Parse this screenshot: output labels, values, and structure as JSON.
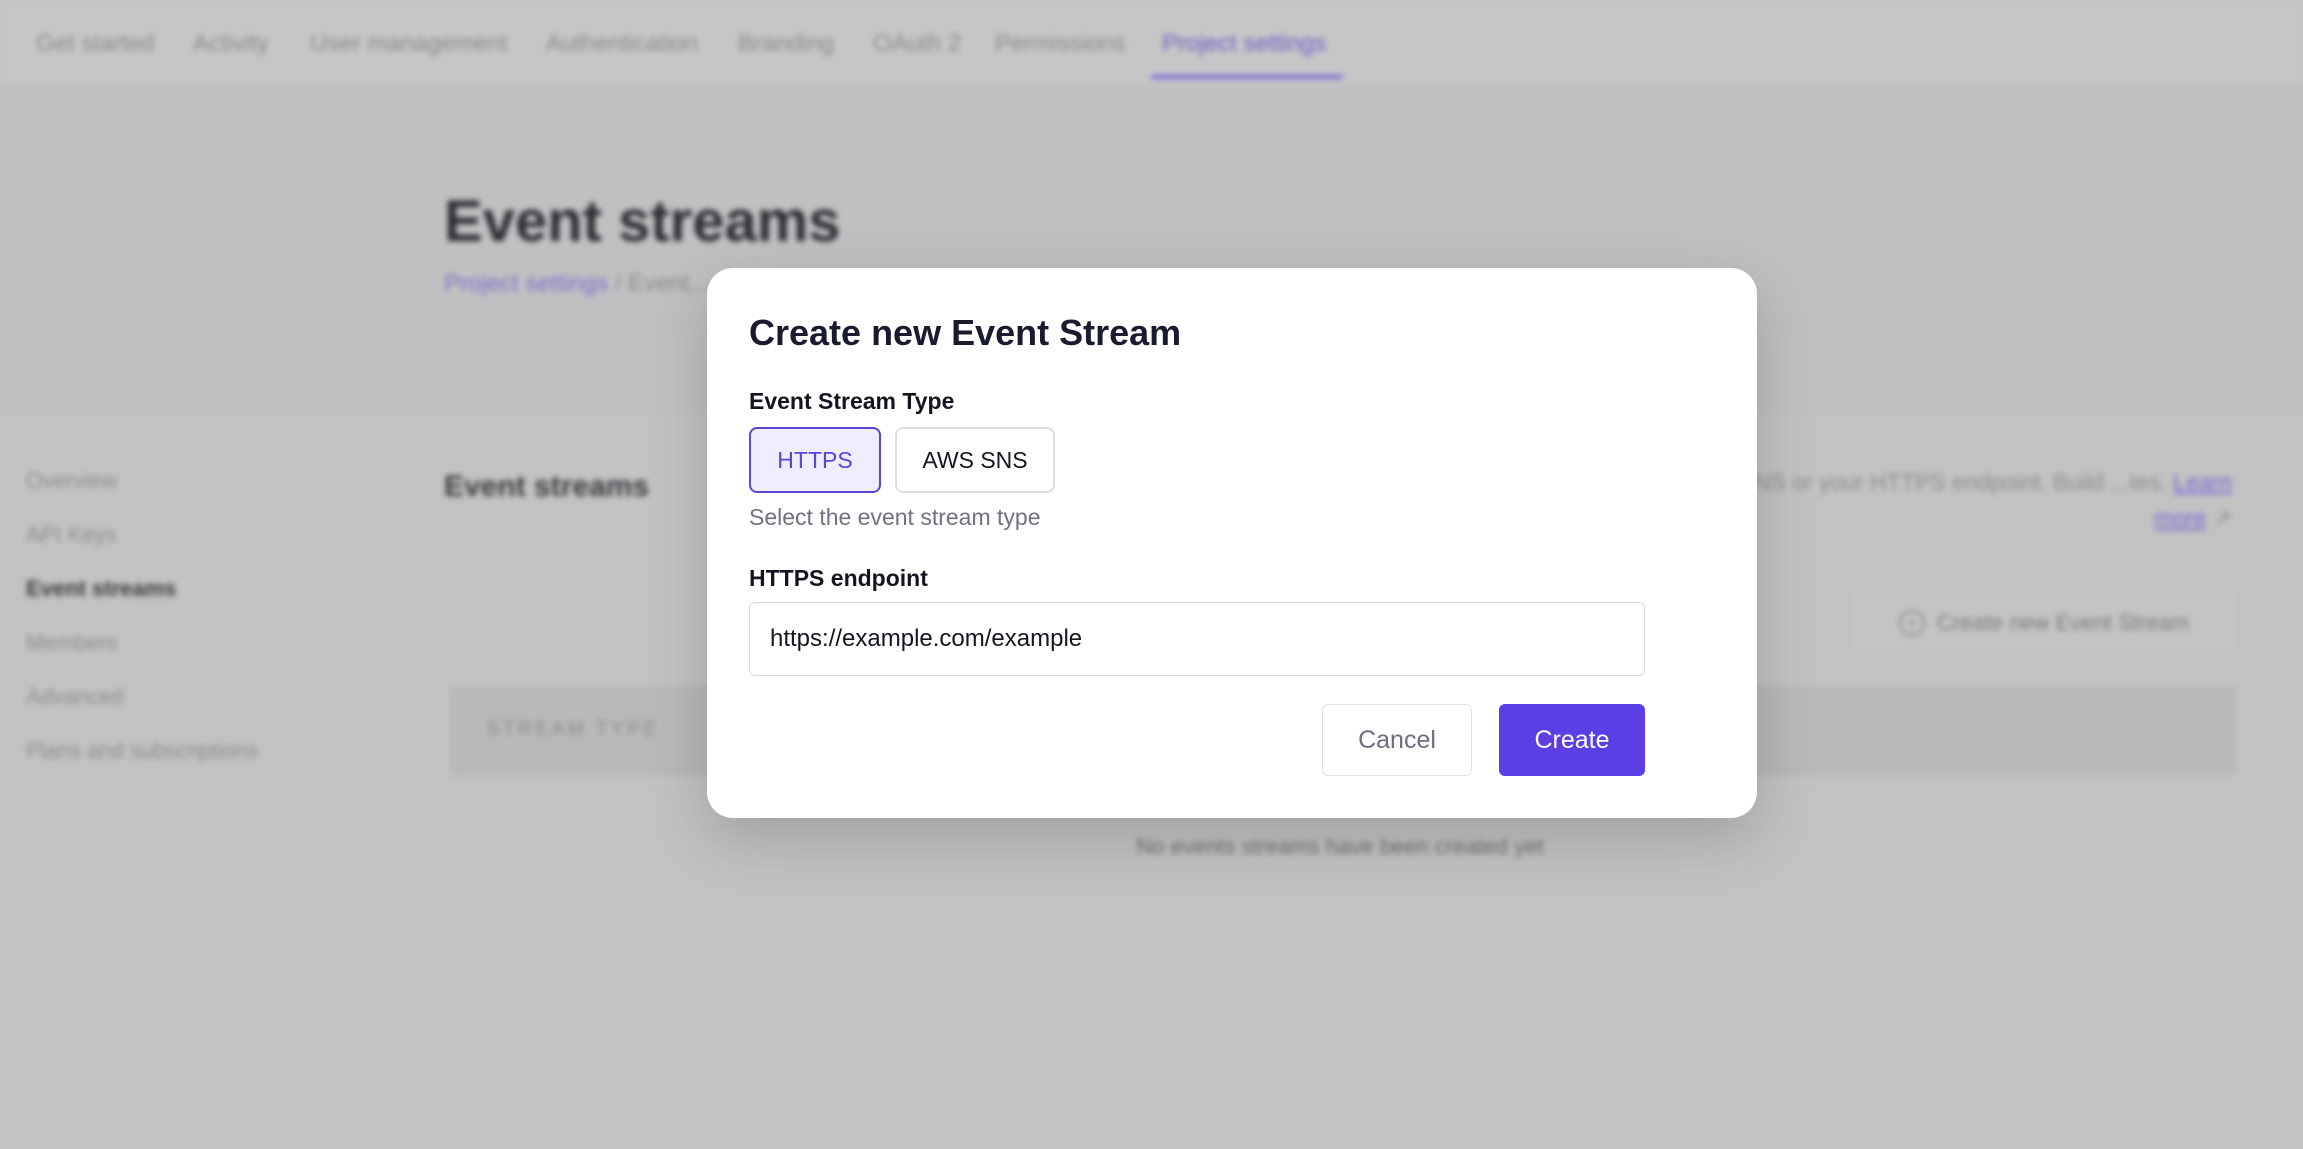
{
  "topnav": {
    "items": [
      {
        "label": "Get started"
      },
      {
        "label": "Activity"
      },
      {
        "label": "User management"
      },
      {
        "label": "Authentication"
      },
      {
        "label": "Branding"
      },
      {
        "label": "OAuth 2"
      },
      {
        "label": "Permissions"
      },
      {
        "label": "Project settings"
      }
    ],
    "active_label": "Project settings",
    "accent_color": "#7466d4"
  },
  "header": {
    "title": "Event streams",
    "breadcrumb": {
      "link": "Project settings",
      "separator": "/",
      "current": "Event..."
    }
  },
  "sidebar": {
    "items": [
      {
        "label": "Overview"
      },
      {
        "label": "API Keys"
      },
      {
        "label": "Event streams"
      },
      {
        "label": "Members"
      },
      {
        "label": "Advanced"
      },
      {
        "label": "Plans and subscriptions"
      }
    ],
    "active_label": "Event streams"
  },
  "main": {
    "section_heading": "Event streams",
    "description": "...SNS or your HTTPS endpoint. Build ...tes.",
    "learn_more": "Learn more",
    "create_button_label": "Create new Event Stream",
    "create_button_icon": "plus-circle-icon",
    "table_header_label": "STREAM TYPE",
    "empty_state": "No events streams have been created yet"
  },
  "modal": {
    "title": "Create new Event Stream",
    "type_label": "Event Stream Type",
    "type_options": [
      {
        "label": "HTTPS",
        "selected": true
      },
      {
        "label": "AWS SNS",
        "selected": false
      }
    ],
    "type_helper": "Select the event stream type",
    "endpoint_label": "HTTPS endpoint",
    "endpoint_value": "https://example.com/example",
    "cancel_label": "Cancel",
    "create_label": "Create",
    "primary_color": "#5b3fe4"
  }
}
